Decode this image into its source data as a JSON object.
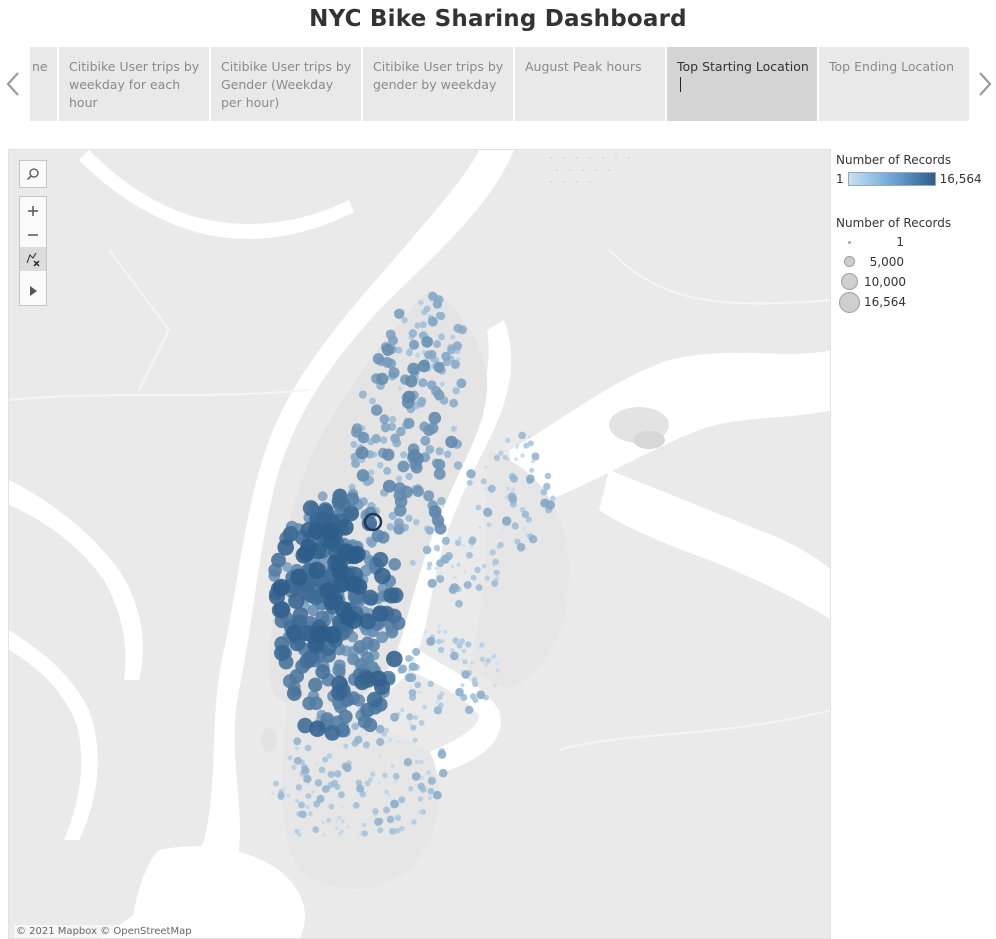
{
  "header": {
    "title": "NYC Bike Sharing Dashboard"
  },
  "storyline": {
    "tabs": [
      {
        "label": "ne",
        "active": false
      },
      {
        "label": "Citibike User trips by weekday for each hour",
        "active": false
      },
      {
        "label": "Citibike User trips by Gender (Weekday per hour)",
        "active": false
      },
      {
        "label": "Citibike User trips by gender by weekday",
        "active": false
      },
      {
        "label": "August Peak hours",
        "active": false
      },
      {
        "label": "Top Starting Location",
        "active": true
      },
      {
        "label": "Top Ending Location",
        "active": false
      }
    ]
  },
  "map": {
    "attribution": "© 2021 Mapbox © OpenStreetMap",
    "toolbar": [
      "search-icon",
      "zoom-in-icon",
      "zoom-out-icon",
      "pin-reset-icon",
      "play-icon"
    ]
  },
  "legend": {
    "color": {
      "title": "Number of Records",
      "min": "1",
      "max": "16,564",
      "color_low": "#c8e1f2",
      "color_high": "#2e5d8a"
    },
    "size": {
      "title": "Number of Records",
      "items": [
        "1",
        "5,000",
        "10,000",
        "16,564"
      ]
    }
  },
  "colors": {
    "water": "#ffffff",
    "land": "#ececec",
    "accent": "#2e5d8a",
    "light_point": "#9cc8e8"
  }
}
